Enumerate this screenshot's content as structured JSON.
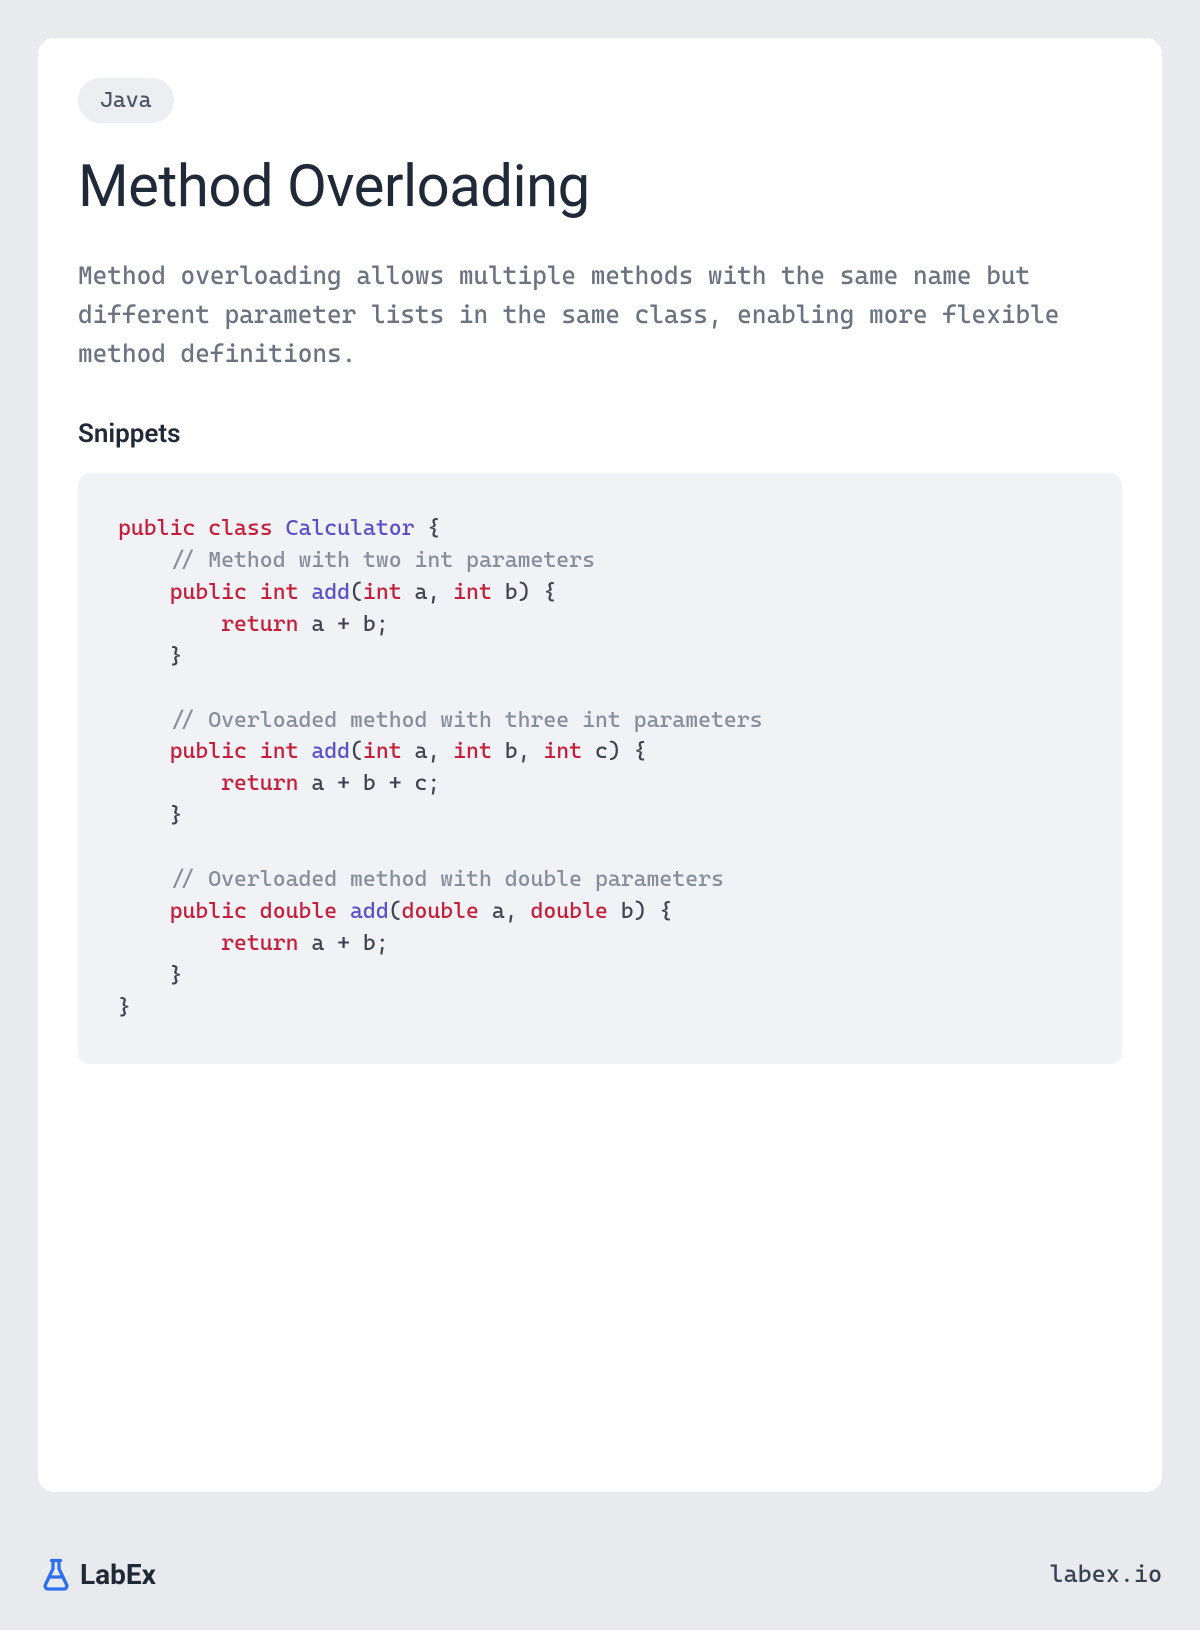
{
  "tag": "Java",
  "title": "Method Overloading",
  "description": "Method overloading allows multiple methods with the same name but different parameter lists in the same class, enabling more flexible method definitions.",
  "section_heading": "Snippets",
  "logo_text": "LabEx",
  "site_url": "labex.io",
  "code": {
    "line1_public": "public",
    "line1_class": "class",
    "line1_name": "Calculator",
    "line1_brace": " {",
    "line2_comment": "// Method with two int parameters",
    "line3_public": "public",
    "line3_rettype": "int",
    "line3_method": "add",
    "line3_lparen": "(",
    "line3_ptype1": "int",
    "line3_pvar1": " a, ",
    "line3_ptype2": "int",
    "line3_pvar2": " b",
    "line3_rparen": ")",
    "line3_brace": " {",
    "line4_return": "return",
    "line4_expr": " a + b;",
    "line5_brace": "}",
    "line7_comment": "// Overloaded method with three int parameters",
    "line8_public": "public",
    "line8_rettype": "int",
    "line8_method": "add",
    "line8_lparen": "(",
    "line8_ptype1": "int",
    "line8_pvar1": " a, ",
    "line8_ptype2": "int",
    "line8_pvar2": " b, ",
    "line8_ptype3": "int",
    "line8_pvar3": " c",
    "line8_rparen": ")",
    "line8_brace": " {",
    "line9_return": "return",
    "line9_expr": " a + b + c;",
    "line10_brace": "}",
    "line12_comment": "// Overloaded method with double parameters",
    "line13_public": "public",
    "line13_rettype": "double",
    "line13_method": "add",
    "line13_lparen": "(",
    "line13_ptype1": "double",
    "line13_pvar1": " a, ",
    "line13_ptype2": "double",
    "line13_pvar2": " b",
    "line13_rparen": ")",
    "line13_brace": " {",
    "line14_return": "return",
    "line14_expr": " a + b;",
    "line15_brace": "}",
    "line16_brace": "}"
  }
}
